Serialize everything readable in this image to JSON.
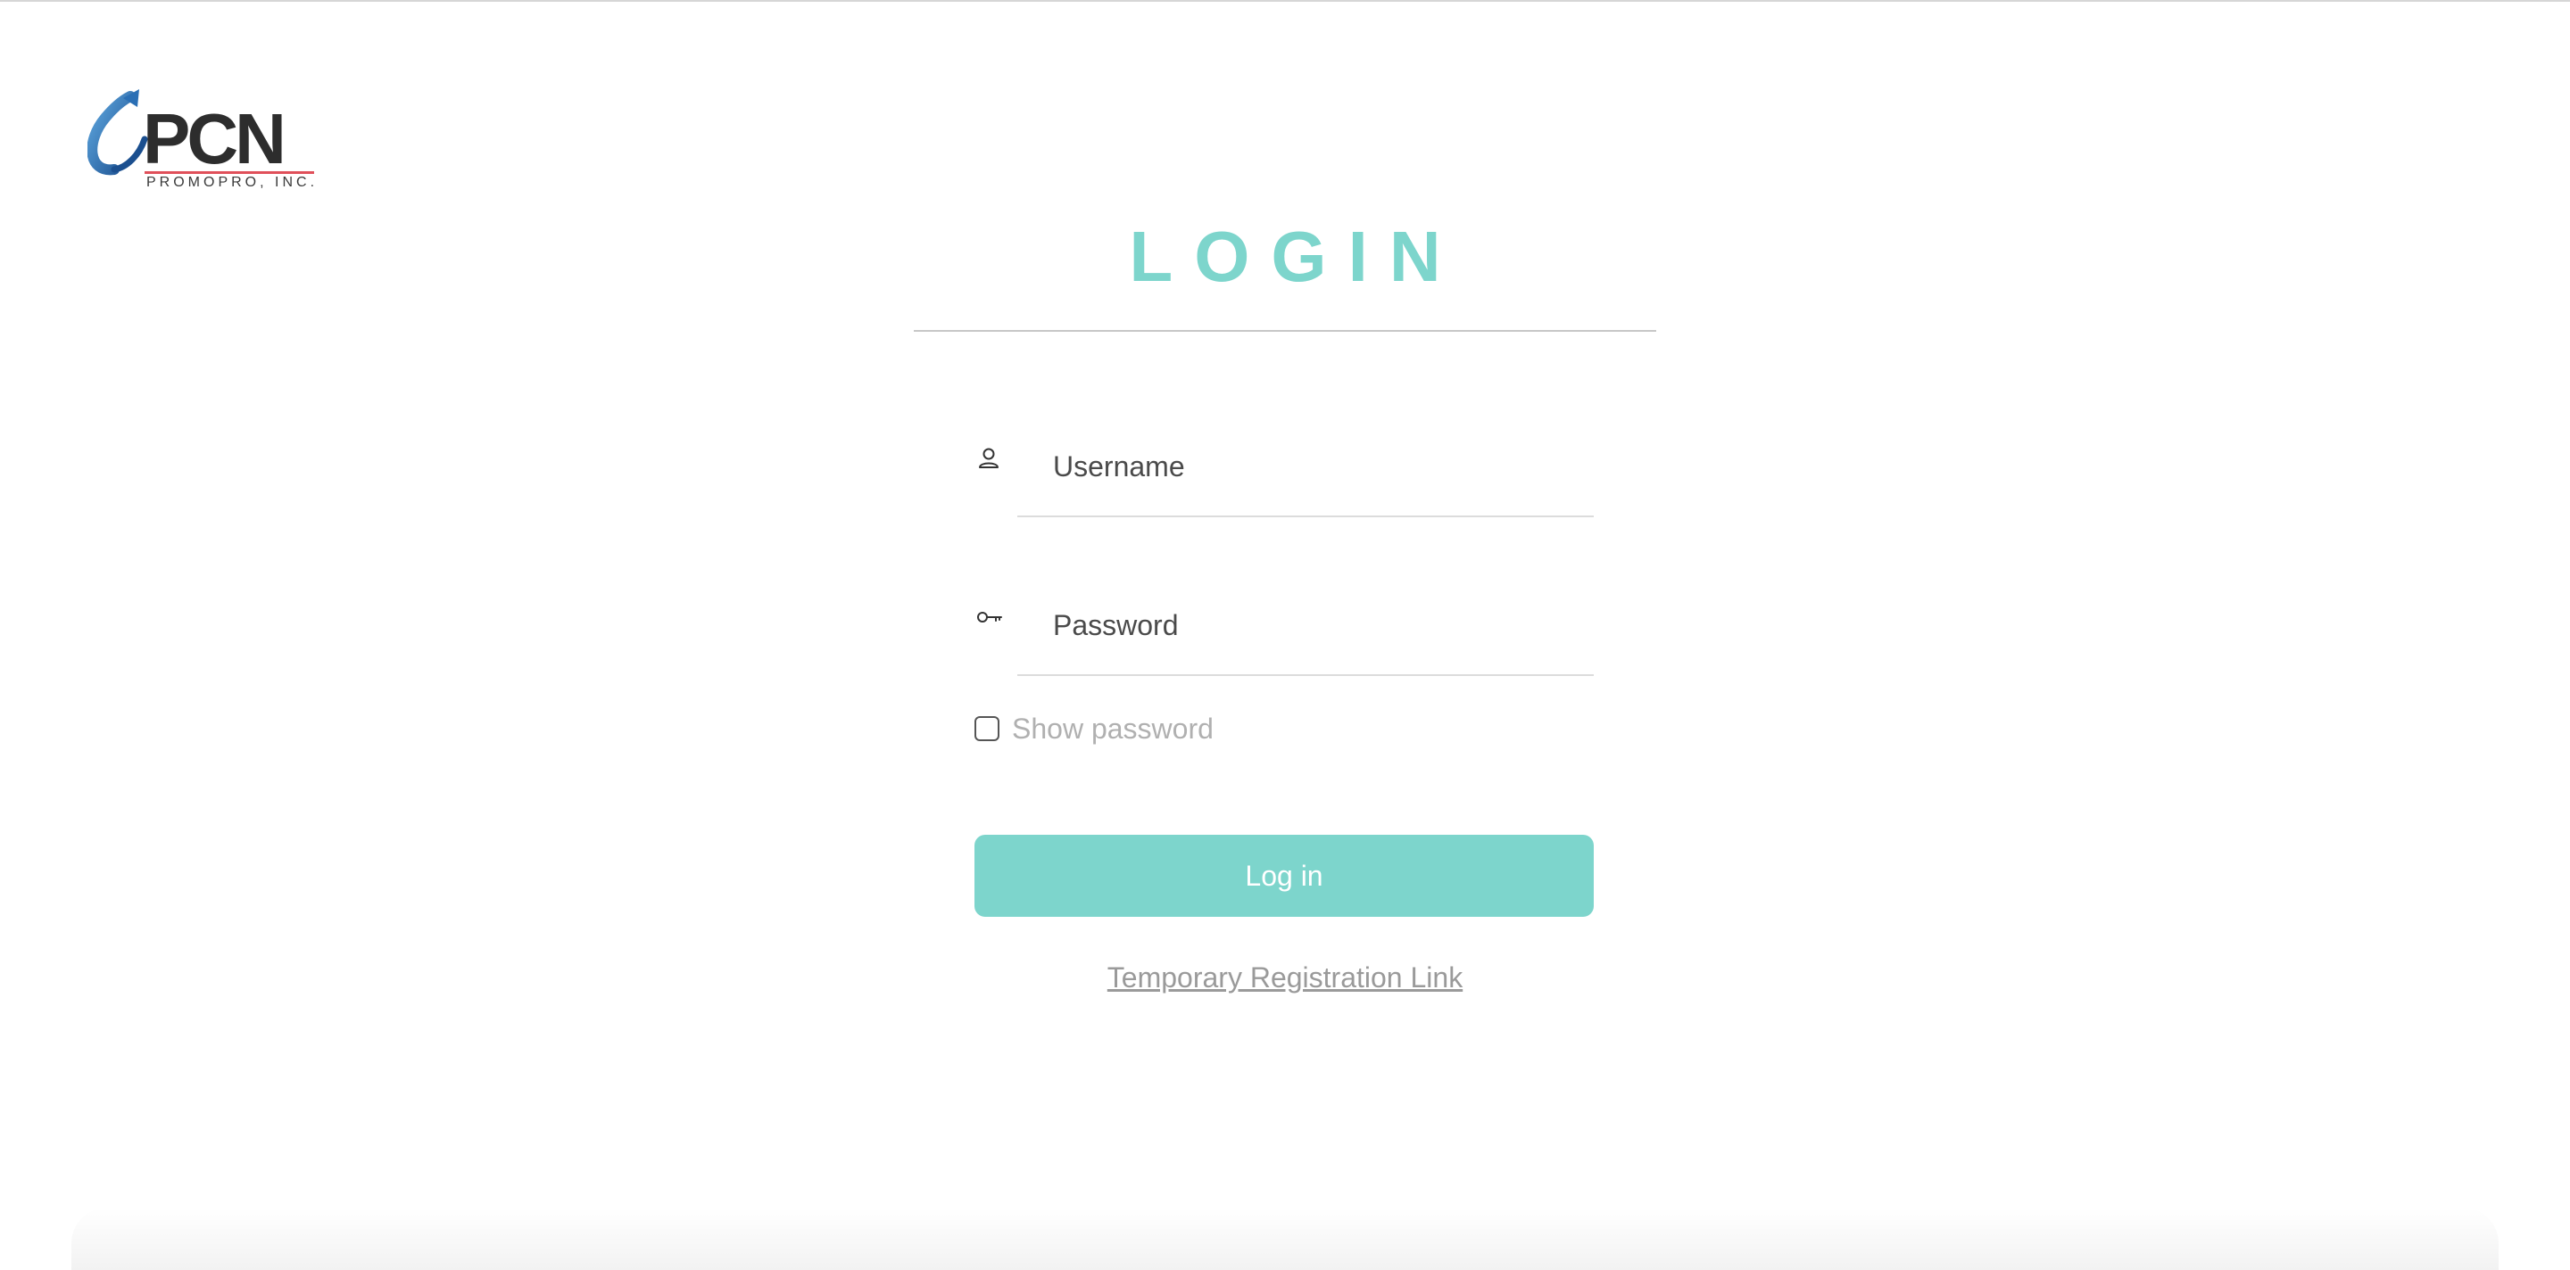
{
  "logo": {
    "brand": "PCN",
    "subtitle": "PROMOPRO, INC."
  },
  "login": {
    "title": "LOGIN",
    "username_placeholder": "Username",
    "password_placeholder": "Password",
    "show_password_label": "Show password",
    "submit_label": "Log in",
    "registration_link": "Temporary Registration Link"
  },
  "icons": {
    "username": "user-icon",
    "password": "key-icon",
    "logo_swoosh": "arrow-swoosh-icon"
  },
  "colors": {
    "accent": "#7dd5cc",
    "link": "#9a9a9a",
    "logo_blue": "#2a6fb5",
    "logo_red_line": "#e0505a"
  }
}
